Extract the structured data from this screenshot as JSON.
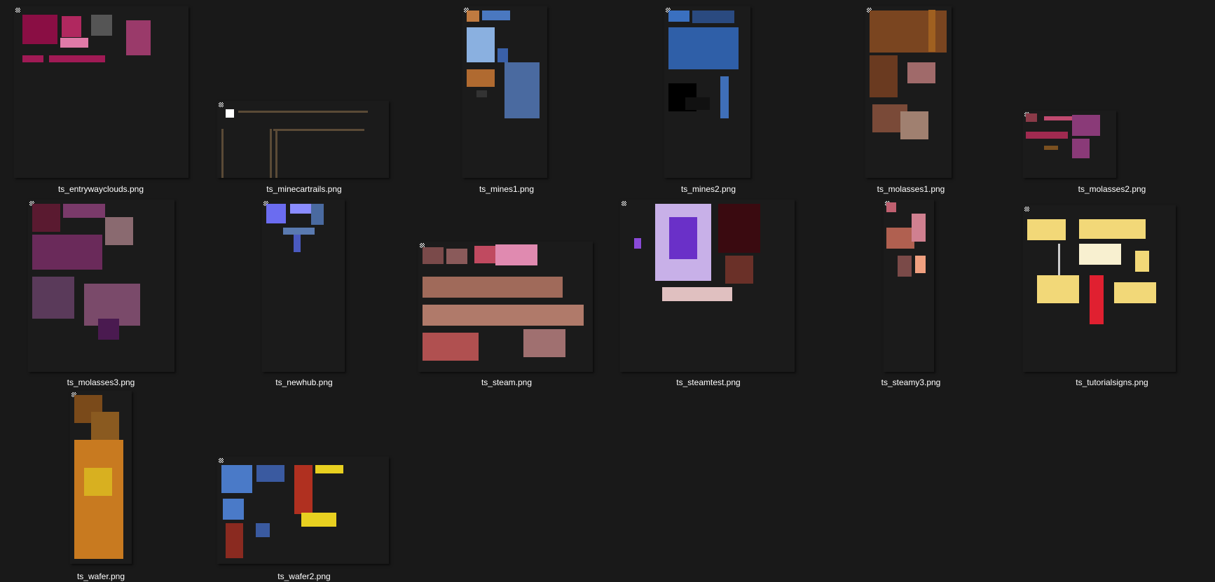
{
  "files": [
    {
      "name": "ts_entrywayclouds.png",
      "accent": "#b0285f"
    },
    {
      "name": "ts_minecartrails.png",
      "accent": "#5a4a36"
    },
    {
      "name": "ts_mines1.png",
      "accent": "#5a7fc8"
    },
    {
      "name": "ts_mines2.png",
      "accent": "#3f6fb8"
    },
    {
      "name": "ts_molasses1.png",
      "accent": "#8a4a20"
    },
    {
      "name": "ts_molasses2.png",
      "accent": "#8a3a78"
    },
    {
      "name": "ts_molasses3.png",
      "accent": "#6a3a6a"
    },
    {
      "name": "ts_newhub.png",
      "accent": "#6b6cf0"
    },
    {
      "name": "ts_steam.png",
      "accent": "#e08ab0"
    },
    {
      "name": "ts_steamtest.png",
      "accent": "#8a4ad8"
    },
    {
      "name": "ts_steamy3.png",
      "accent": "#c06070"
    },
    {
      "name": "ts_tutorialsigns.png",
      "accent": "#f2d878"
    },
    {
      "name": "ts_wafer.png",
      "accent": "#c87a20"
    },
    {
      "name": "ts_wafer2.png",
      "accent": "#4a7ac8"
    }
  ]
}
